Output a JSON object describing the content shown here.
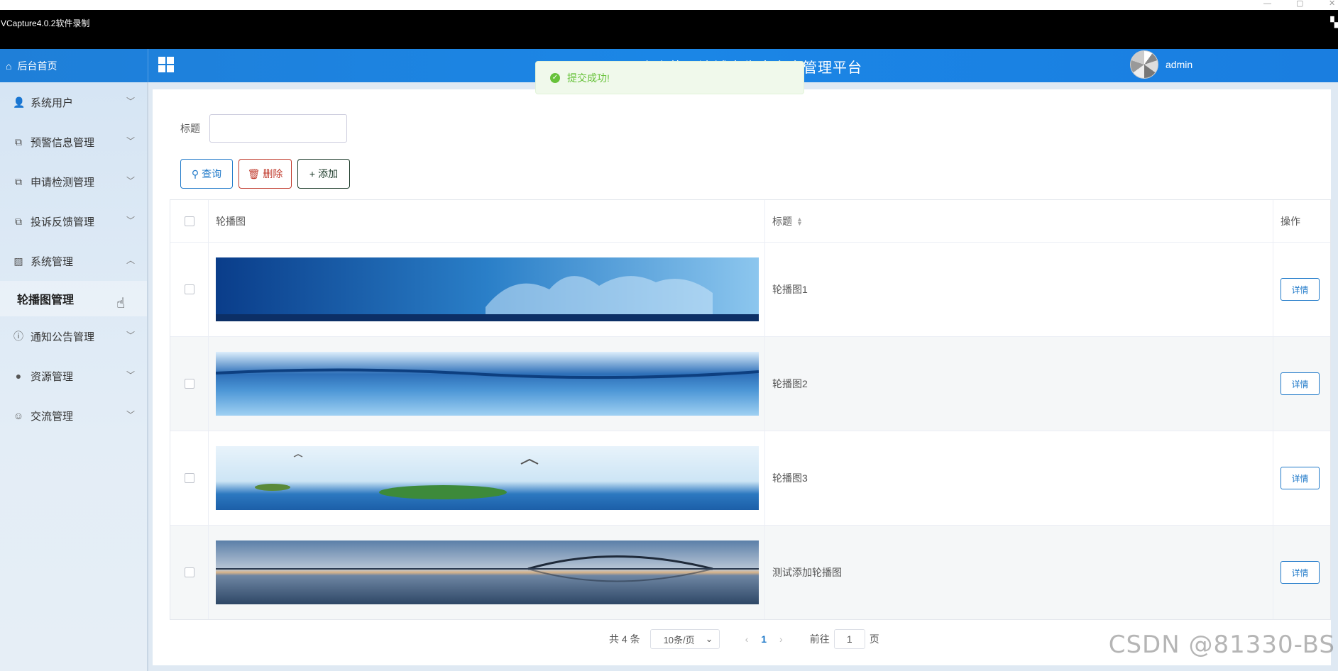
{
  "recorder": {
    "title": "VCapture4.0.2软件录制"
  },
  "header": {
    "home_label": "后台首页",
    "app_title": "欢迎使用流域水生态安全管理平台",
    "user_name": "admin"
  },
  "toast": {
    "message": "提交成功!"
  },
  "sidebar": {
    "items": [
      {
        "label": "系统用户",
        "icon": "user-icon"
      },
      {
        "label": "预警信息管理",
        "icon": "document-icon"
      },
      {
        "label": "申请检测管理",
        "icon": "document-icon"
      },
      {
        "label": "投诉反馈管理",
        "icon": "document-icon"
      },
      {
        "label": "系统管理",
        "icon": "image-icon",
        "expanded": true
      },
      {
        "label": "轮播图管理",
        "sub": true,
        "active": true
      },
      {
        "label": "通知公告管理",
        "icon": "info-icon"
      },
      {
        "label": "资源管理",
        "icon": "location-icon"
      },
      {
        "label": "交流管理",
        "icon": "chat-icon"
      }
    ]
  },
  "search": {
    "label": "标题",
    "value": ""
  },
  "toolbar": {
    "query_label": "查询",
    "delete_label": "删除",
    "add_label": "添加"
  },
  "table": {
    "headers": {
      "image": "轮播图",
      "title": "标题",
      "operation": "操作"
    },
    "rows": [
      {
        "title": "轮播图1",
        "image": "water-splash-blue",
        "action": "详情"
      },
      {
        "title": "轮播图2",
        "image": "water-surface",
        "action": "详情"
      },
      {
        "title": "轮播图3",
        "image": "water-splash-leaf-birds",
        "action": "详情"
      },
      {
        "title": "测试添加轮播图",
        "image": "bridge-sunset",
        "action": "详情"
      }
    ]
  },
  "pagination": {
    "total_text": "共 4 条",
    "page_size": "10条/页",
    "current_page": "1",
    "goto_prefix": "前往",
    "goto_value": "1",
    "goto_suffix": "页"
  },
  "watermark": "CSDN @81330-BS",
  "colors": {
    "primary": "#1f79c9",
    "danger": "#c0392b",
    "success": "#67c23a",
    "header": "#1b86e6"
  }
}
